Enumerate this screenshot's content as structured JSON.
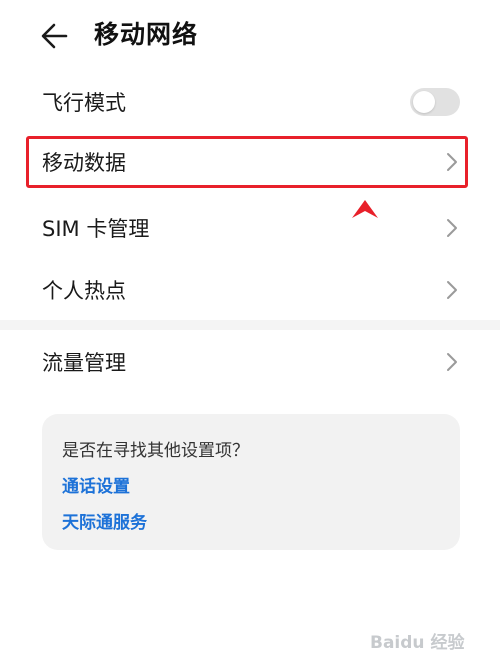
{
  "header": {
    "title": "移动网络"
  },
  "settings": {
    "items": [
      {
        "label": "飞行模式",
        "type": "toggle",
        "enabled": false
      },
      {
        "label": "移动数据",
        "type": "link",
        "highlighted": true
      },
      {
        "label": "SIM 卡管理",
        "type": "link"
      },
      {
        "label": "个人热点",
        "type": "link"
      },
      {
        "label": "流量管理",
        "type": "link"
      }
    ]
  },
  "suggestions": {
    "question": "是否在寻找其他设置项？",
    "links": [
      {
        "label": "通话设置"
      },
      {
        "label": "天际通服务"
      }
    ]
  },
  "colors": {
    "accent_link": "#1d72d8",
    "highlight": "#e8202a",
    "toggle_off": "#e1e1e1",
    "card_background": "#f2f2f2"
  },
  "icons": {
    "back": "arrow-left-icon",
    "chevron": "chevron-right-icon",
    "watermark": "baidu-jingyan-logo"
  },
  "watermark": {
    "text": "Baidu 经验"
  }
}
